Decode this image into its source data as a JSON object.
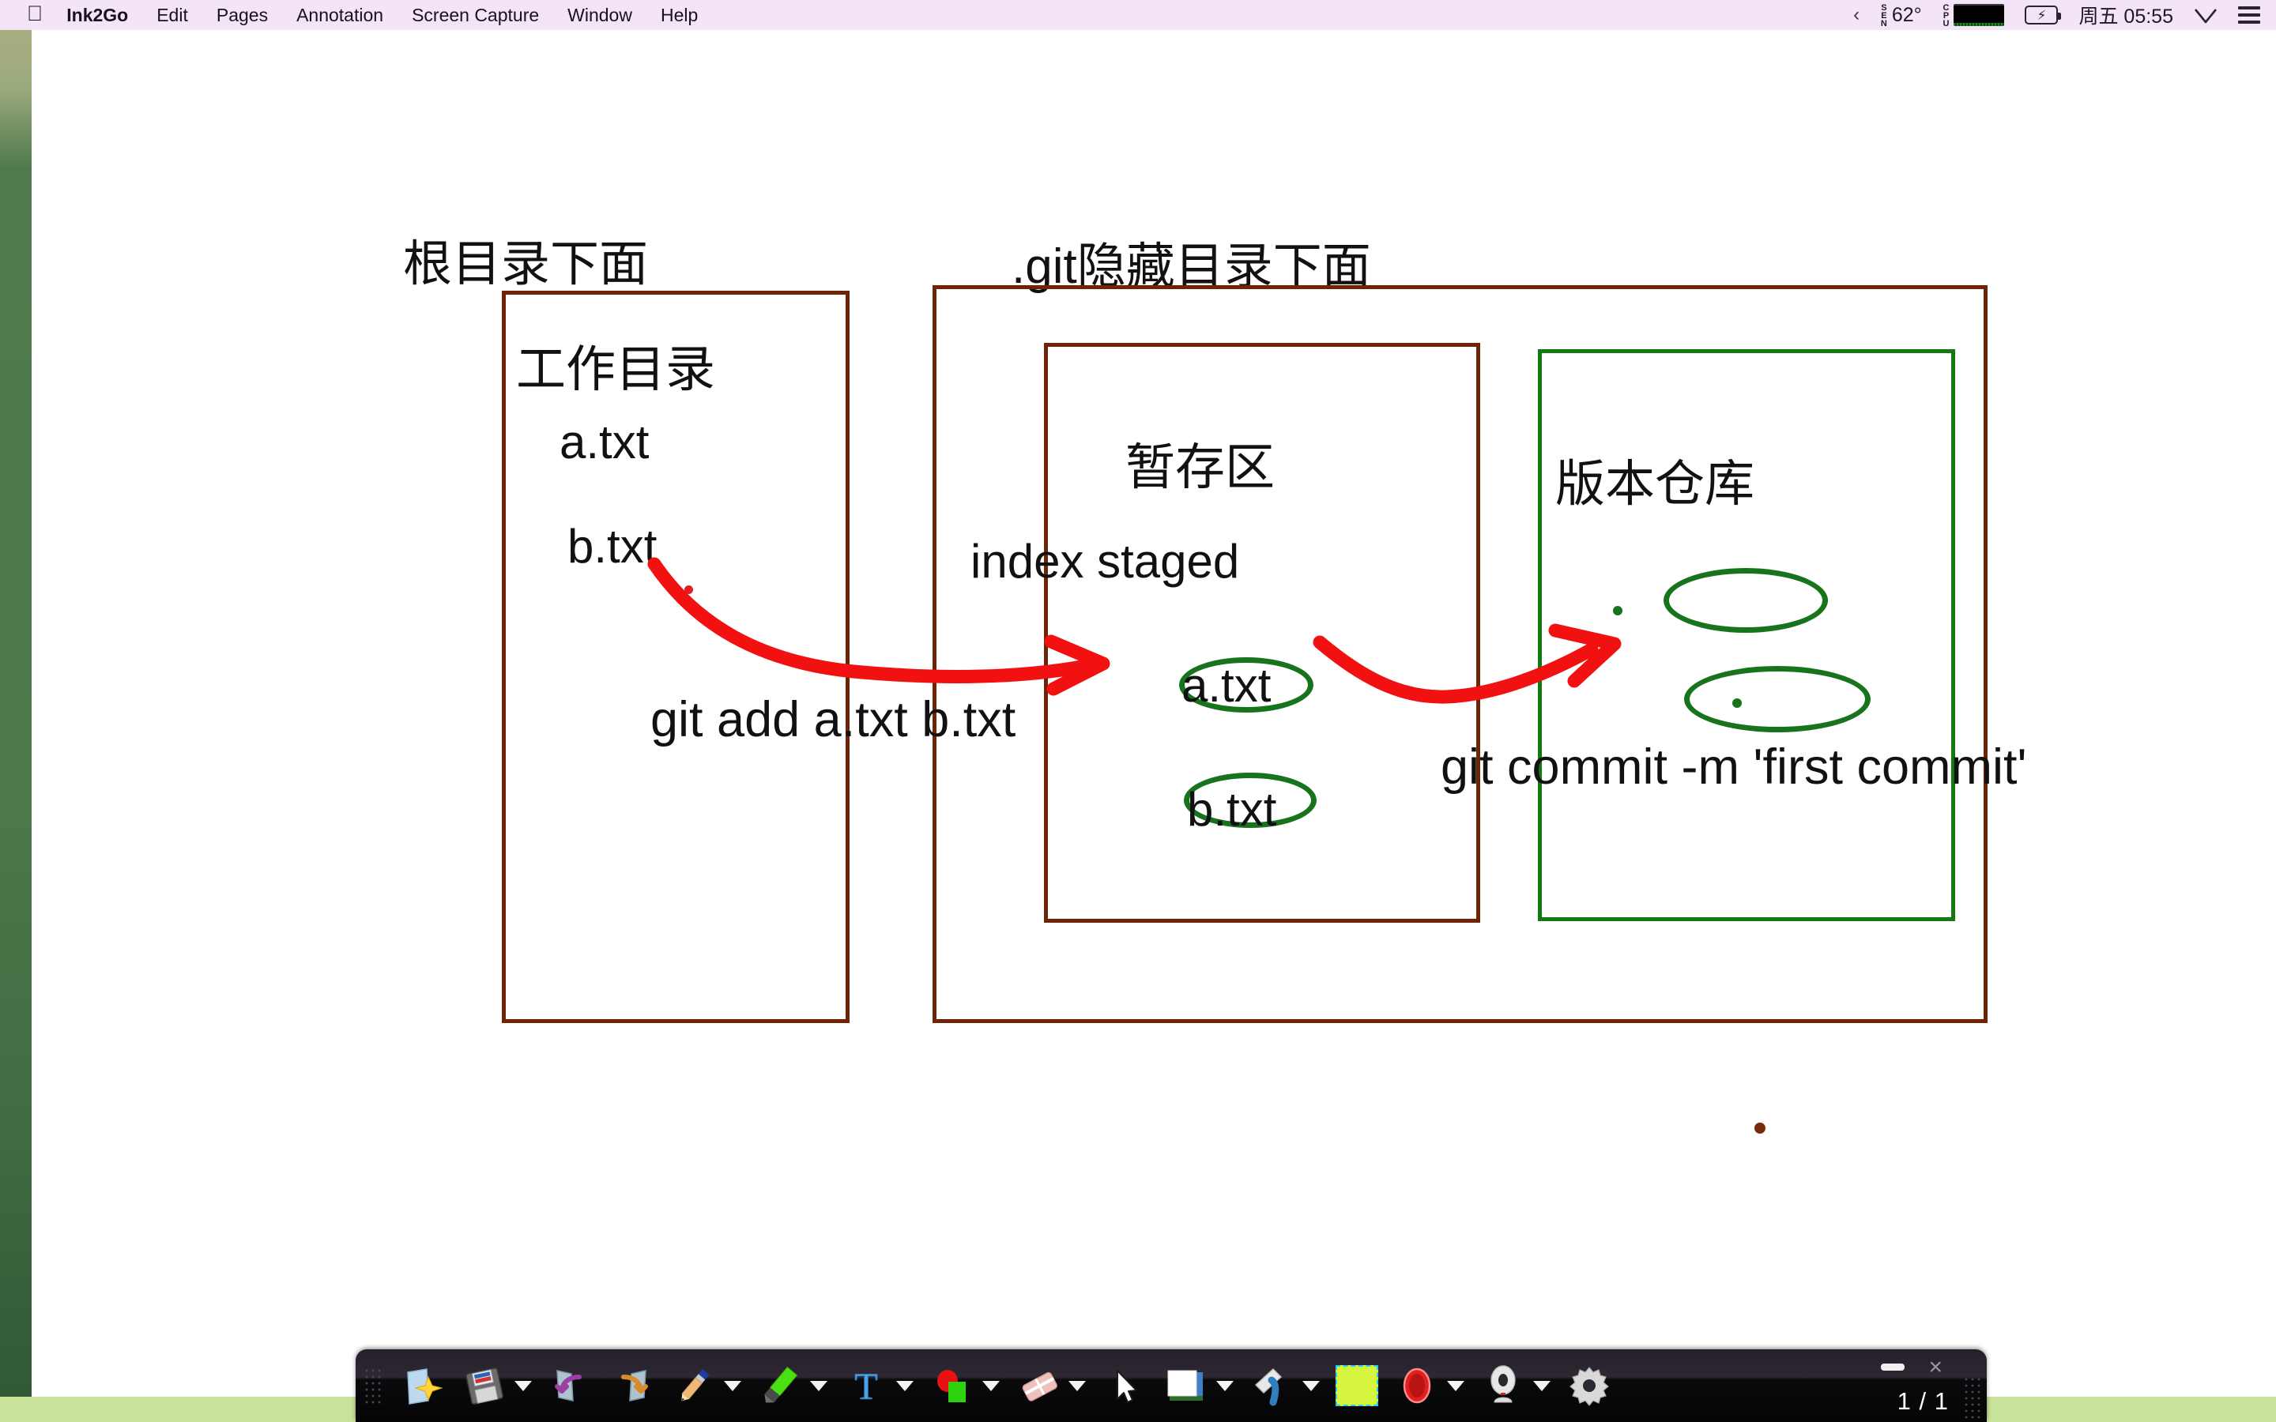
{
  "menubar": {
    "apple_icon": "apple-icon",
    "app_name": "Ink2Go",
    "items": [
      "Edit",
      "Pages",
      "Annotation",
      "Screen Capture",
      "Window",
      "Help"
    ],
    "status": {
      "back_chevron": "‹",
      "sensor_label": "SEN",
      "sensor_value": "62°",
      "cpu_label": "CPU",
      "cpu_graph_icon": "cpu-graph-icon",
      "battery_icon": "battery-charging-icon",
      "clock": "周五 05:55",
      "wifi_icon": "wifi-icon",
      "control_center_icon": "control-center-icon"
    }
  },
  "diagram": {
    "labels": {
      "root_dir": "根目录下面",
      "git_dir": ".git隐藏目录下面",
      "working_dir": "工作目录",
      "working_file_a": "a.txt",
      "working_file_b": "b.txt",
      "staging": "暂存区",
      "index_staged": "index  staged",
      "staged_file_a": "a.txt",
      "staged_file_b": "b.txt",
      "repository": "版本仓库",
      "cmd_add": "git add a.txt  b.txt",
      "cmd_commit": "git commit -m 'first commit'"
    },
    "colors": {
      "box_brown": "#6f2407",
      "box_green": "#137a13",
      "ellipse_green": "#18741c",
      "arrow_red": "#f21111",
      "text_black": "#111111"
    }
  },
  "toolbar": {
    "tools": [
      {
        "name": "new-page-icon",
        "label": "New Page",
        "has_caret": false
      },
      {
        "name": "save-icon",
        "label": "Save",
        "has_caret": true
      },
      {
        "name": "undo-icon",
        "label": "Undo",
        "has_caret": false
      },
      {
        "name": "redo-icon",
        "label": "Redo",
        "has_caret": false
      },
      {
        "name": "pencil-icon",
        "label": "Pen",
        "has_caret": true
      },
      {
        "name": "highlighter-icon",
        "label": "Highlighter",
        "has_caret": true
      },
      {
        "name": "text-tool-icon",
        "label": "Text",
        "has_caret": true
      },
      {
        "name": "shapes-icon",
        "label": "Shapes",
        "has_caret": true
      },
      {
        "name": "eraser-icon",
        "label": "Eraser",
        "has_caret": true
      },
      {
        "name": "pointer-icon",
        "label": "Select",
        "has_caret": false
      },
      {
        "name": "whiteboard-icon",
        "label": "Board",
        "has_caret": true
      },
      {
        "name": "spotlight-icon",
        "label": "Spotlight",
        "has_caret": true
      },
      {
        "name": "screen-region-icon",
        "label": "Region",
        "has_caret": false
      },
      {
        "name": "record-icon",
        "label": "Record",
        "has_caret": true
      },
      {
        "name": "webcam-icon",
        "label": "Webcam",
        "has_caret": true
      },
      {
        "name": "settings-gear-icon",
        "label": "Settings",
        "has_caret": false
      }
    ],
    "minimize_label": "—",
    "close_label": "×",
    "page_indicator": "1 / 1"
  }
}
